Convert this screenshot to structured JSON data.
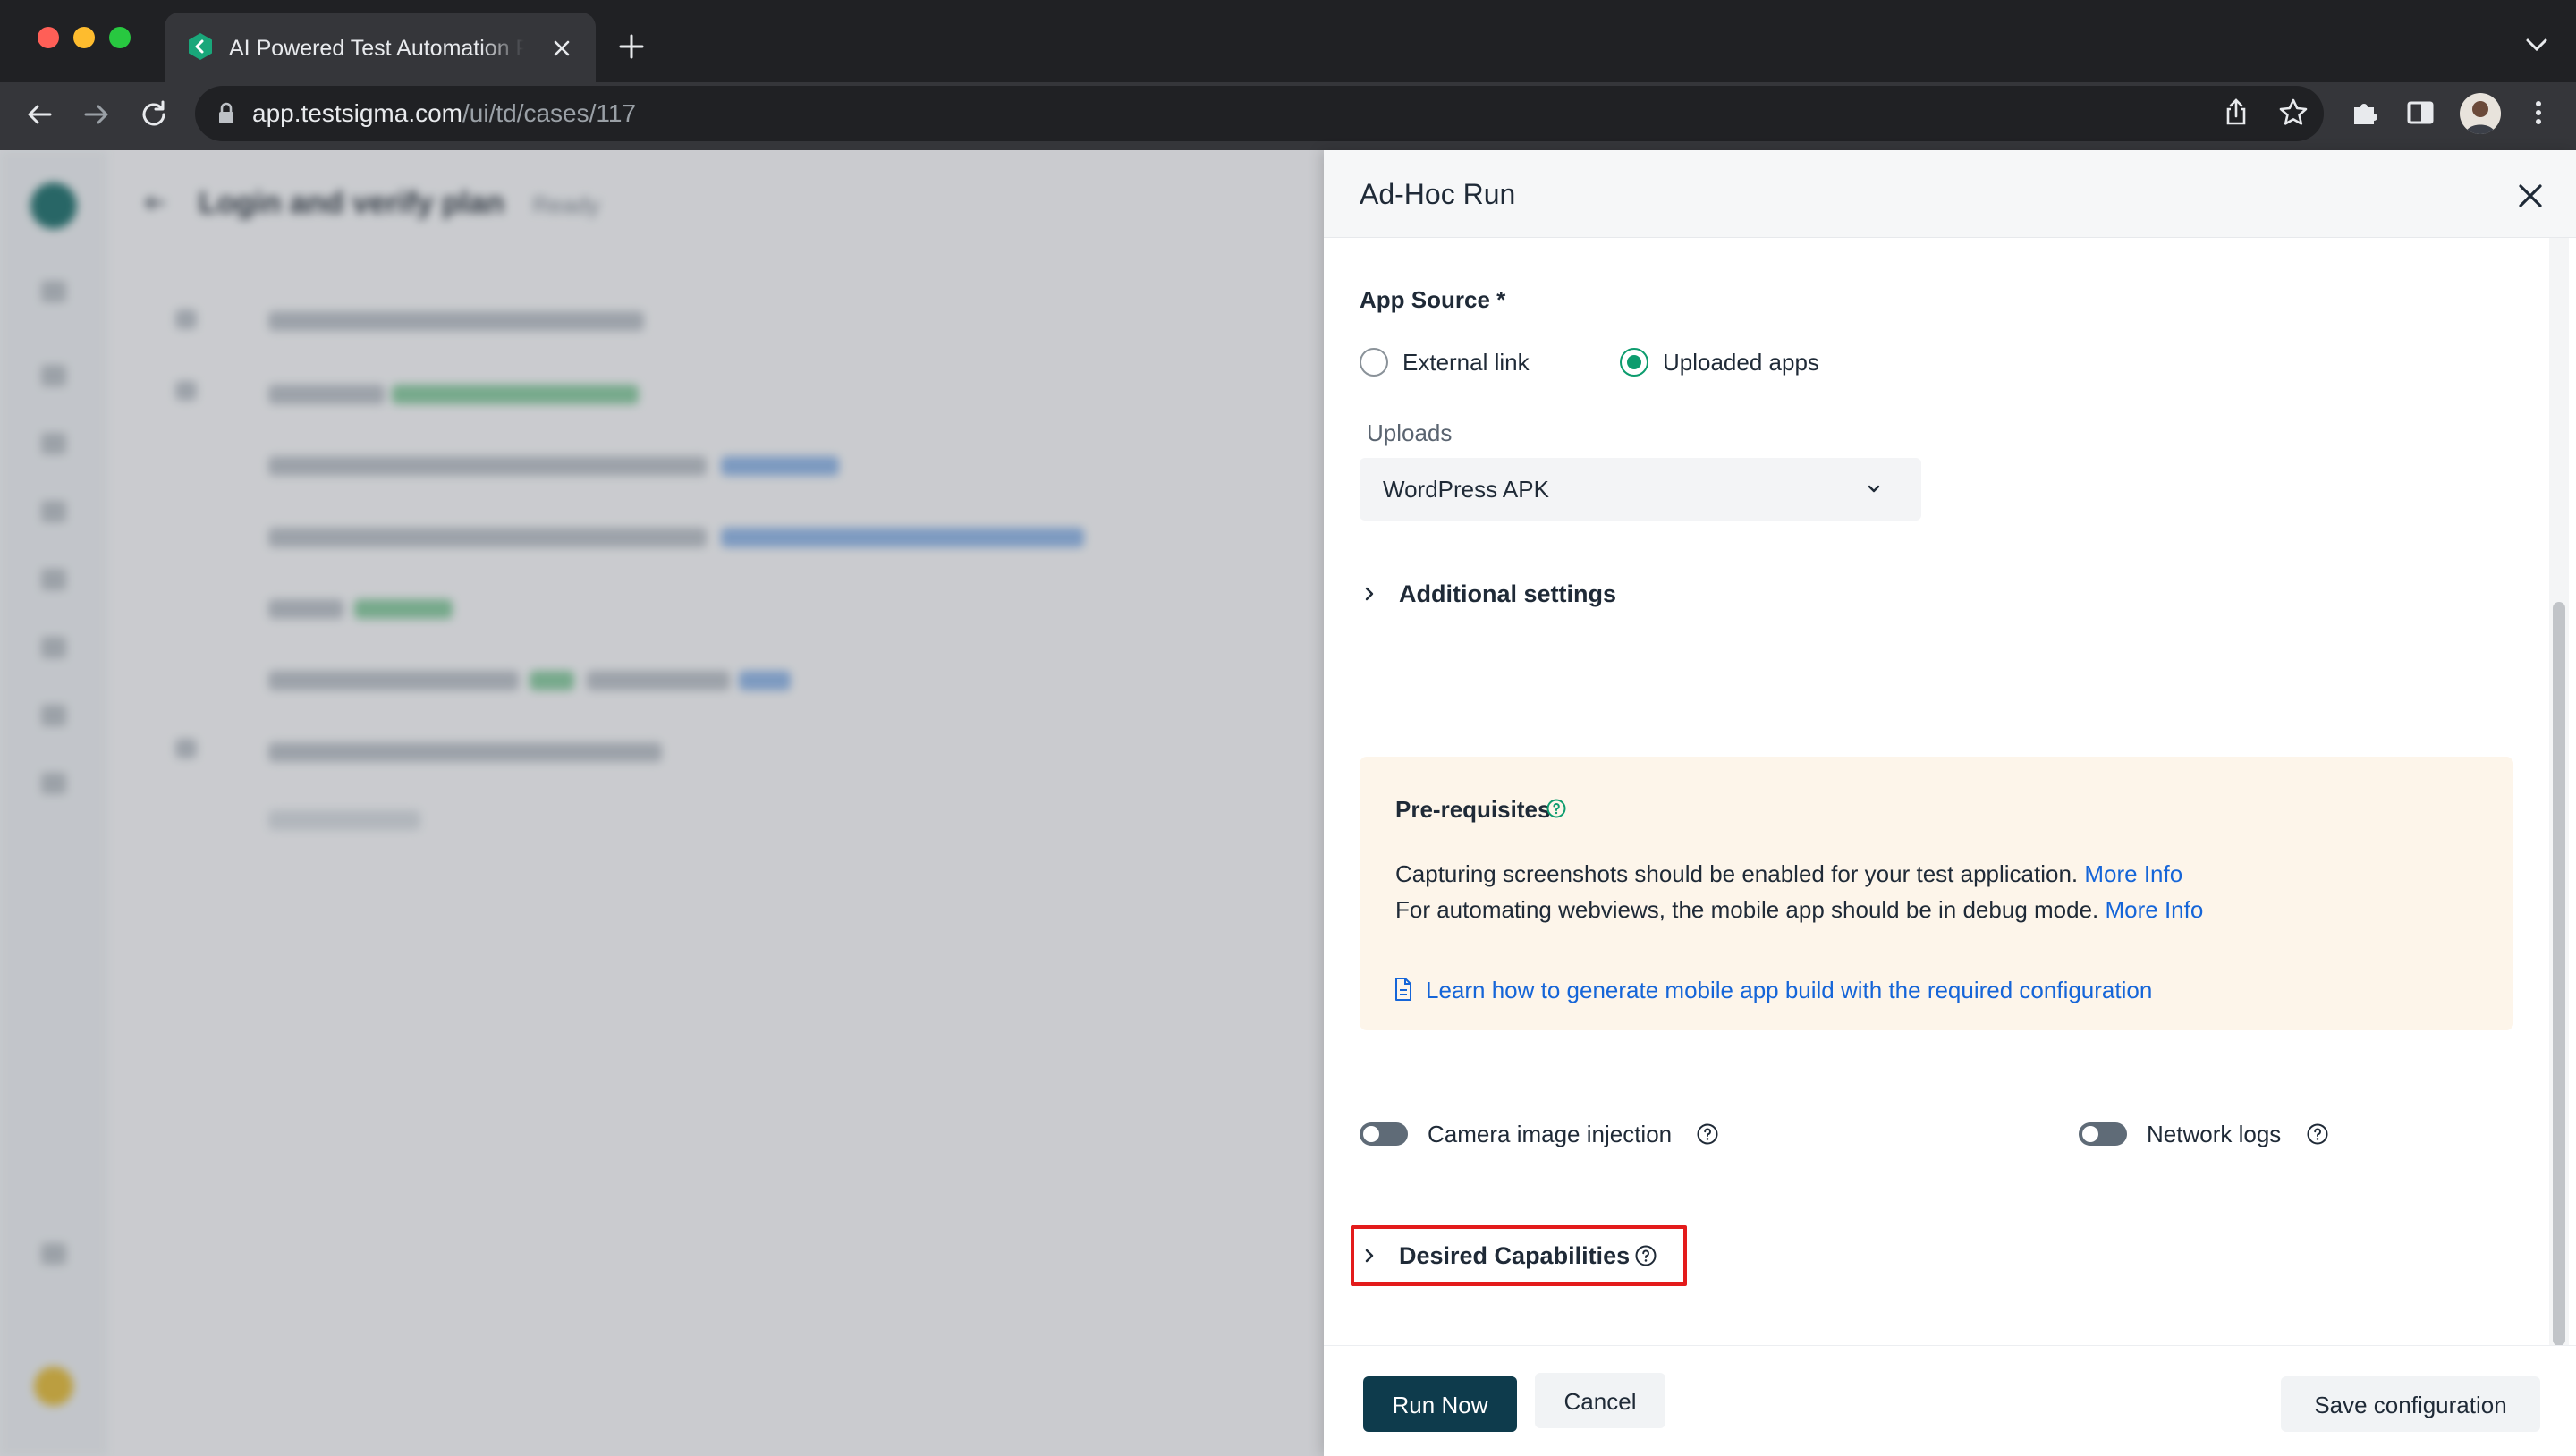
{
  "browser": {
    "tab_title": "AI Powered Test Automation Platform",
    "url_domain": "app.testsigma.com",
    "url_path": "/ui/td/cases/117"
  },
  "background": {
    "page_title": "Login and verify plan",
    "status": "Ready"
  },
  "drawer": {
    "title": "Ad-Hoc Run",
    "app_source": {
      "label": "App Source *",
      "options": [
        {
          "label": "External link",
          "selected": false
        },
        {
          "label": "Uploaded apps",
          "selected": true
        }
      ]
    },
    "uploads": {
      "label": "Uploads",
      "value": "WordPress APK"
    },
    "additional_settings": "Additional settings",
    "prerequisites": {
      "title": "Pre-requisites",
      "line1": "Capturing screenshots should be enabled for your test application.",
      "line1_link": "More Info",
      "line2": "For automating webviews, the mobile app should be in debug mode.",
      "line2_link": "More Info",
      "doc_link": "Learn how to generate mobile app build with the required configuration"
    },
    "toggles": {
      "camera": {
        "label": "Camera image injection",
        "on": false
      },
      "network": {
        "label": "Network logs",
        "on": false
      }
    },
    "desired_capabilities": "Desired Capabilities",
    "footer": {
      "run_now": "Run Now",
      "cancel": "Cancel",
      "save": "Save configuration"
    }
  },
  "colors": {
    "accent_green": "#0d9c6e",
    "link_blue": "#1565d8",
    "primary_button": "#0e3b4c",
    "highlight_red": "#e31b1b",
    "prereq_bg": "#fdf5ea"
  }
}
